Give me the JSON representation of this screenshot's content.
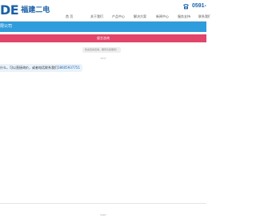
{
  "header": {
    "logo_mark": "DE",
    "logo_cn": "福建二电",
    "phone_icon": "phone-icon",
    "phone_number": "0591-",
    "nav": [
      {
        "label": "首 页"
      },
      {
        "label": "关于我们"
      },
      {
        "label": "产品中心"
      },
      {
        "label": "解决方案"
      },
      {
        "label": "新闻中心"
      },
      {
        "label": "服务支持"
      },
      {
        "label": "联系我们"
      }
    ]
  },
  "company_bar": {
    "name": "限公司"
  },
  "chat": {
    "title": "留言咨询",
    "system_notice": "欢迎您的咨询，期待为您服务！",
    "time": "15:57",
    "message_prefix": "什么，可以直接询价，或者电话联系我们",
    "message_phone": "18605937751"
  },
  "footer": {
    "text": "53KF"
  },
  "colors": {
    "brand_blue": "#1a61a8",
    "bar_blue": "#2f9cdc",
    "chat_pink": "#e1456a"
  }
}
